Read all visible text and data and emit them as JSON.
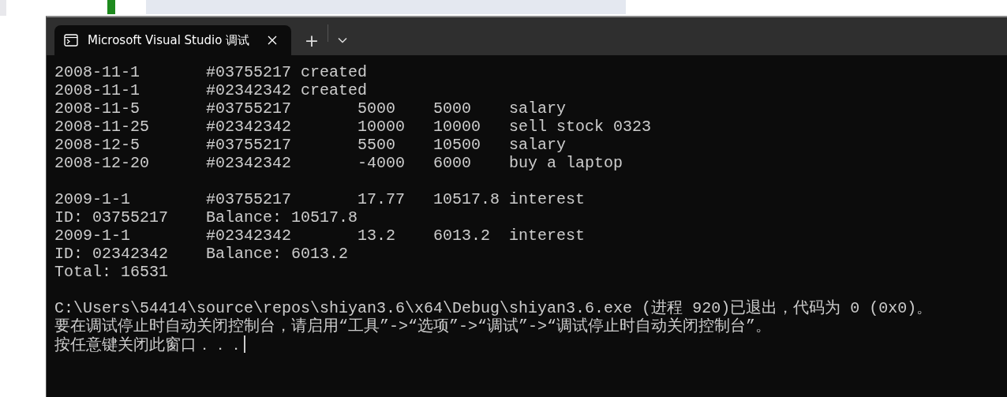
{
  "window": {
    "tabs": [
      {
        "title": "Microsoft Visual Studio 调试",
        "selected": true
      }
    ],
    "new_tab_button": "+"
  },
  "console": {
    "blocks": [
      [
        "2008-11-1       #03755217 created",
        "2008-11-1       #02342342 created",
        "2008-11-5       #03755217       5000    5000    salary",
        "2008-11-25      #02342342       10000   10000   sell stock 0323",
        "2008-12-5       #03755217       5500    10500   salary",
        "2008-12-20      #02342342       -4000   6000    buy a laptop"
      ],
      [
        "2009-1-1        #03755217       17.77   10517.8 interest",
        "ID: 03755217    Balance: 10517.8",
        "2009-1-1        #02342342       13.2    6013.2  interest",
        "ID: 02342342    Balance: 6013.2",
        "Total: 16531"
      ],
      [
        "C:\\Users\\54414\\source\\repos\\shiyan3.6\\x64\\Debug\\shiyan3.6.exe (进程 920)已退出，代码为 0 (0x0)。",
        "要在调试停止时自动关闭控制台，请启用“工具”->“选项”->“调试”->“调试停止时自动关闭控制台”。",
        "按任意键关闭此窗口．．．"
      ]
    ]
  }
}
